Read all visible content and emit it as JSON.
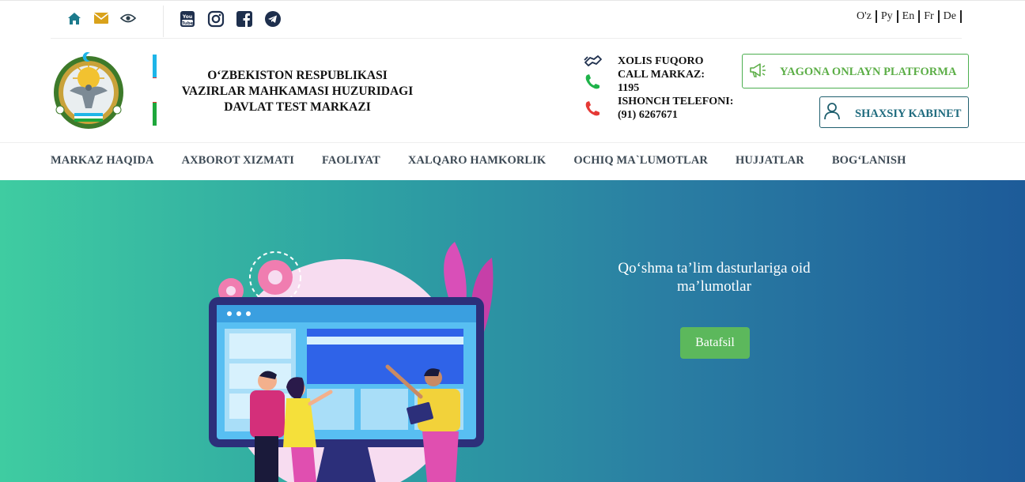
{
  "topbar": {
    "util_icons": [
      "home-icon",
      "mail-icon",
      "eye-icon"
    ],
    "social_icons": [
      "youtube-icon",
      "instagram-icon",
      "facebook-icon",
      "telegram-icon"
    ],
    "languages": [
      "O'z",
      "Py",
      "En",
      "Fr",
      "De"
    ]
  },
  "header": {
    "org_name_line1": "O‘ZBEKISTON RESPUBLIKASI",
    "org_name_line2": "VAZIRLAR MAHKAMASI HUZURIDAGI",
    "org_name_line3": "DAVLAT TEST MARKAZI",
    "contacts": {
      "line1": "XOLIS FUQORO",
      "line2": "CALL MARKAZ:",
      "line3": "1195",
      "line4": "ISHONCH TELEFONI:",
      "line5": "(91) 6267671"
    },
    "platform_button": "YAGONA ONLAYN PLATFORMA",
    "cabinet_button": "SHAXSIY KABINET"
  },
  "nav": {
    "items": [
      "MARKAZ HAQIDA",
      "AXBOROT XIZMATI",
      "FAOLIYAT",
      "XALQARO HAMKORLIK",
      "OCHIQ MA`LUMOTLAR",
      "HUJJATLAR",
      "BOG‘LANISH"
    ]
  },
  "hero": {
    "text_line1": "Qo‘shma ta’lim dasturlariga oid",
    "text_line2": "ma’lumotlar",
    "button": "Batafsil"
  },
  "colors": {
    "accent_green": "#5cb85c",
    "platform_green": "#5cae47",
    "cabinet_teal": "#1f6b7e",
    "icon_teal": "#1c7a8c",
    "gradient_start": "#3fcca1",
    "gradient_end": "#1d5b99"
  }
}
